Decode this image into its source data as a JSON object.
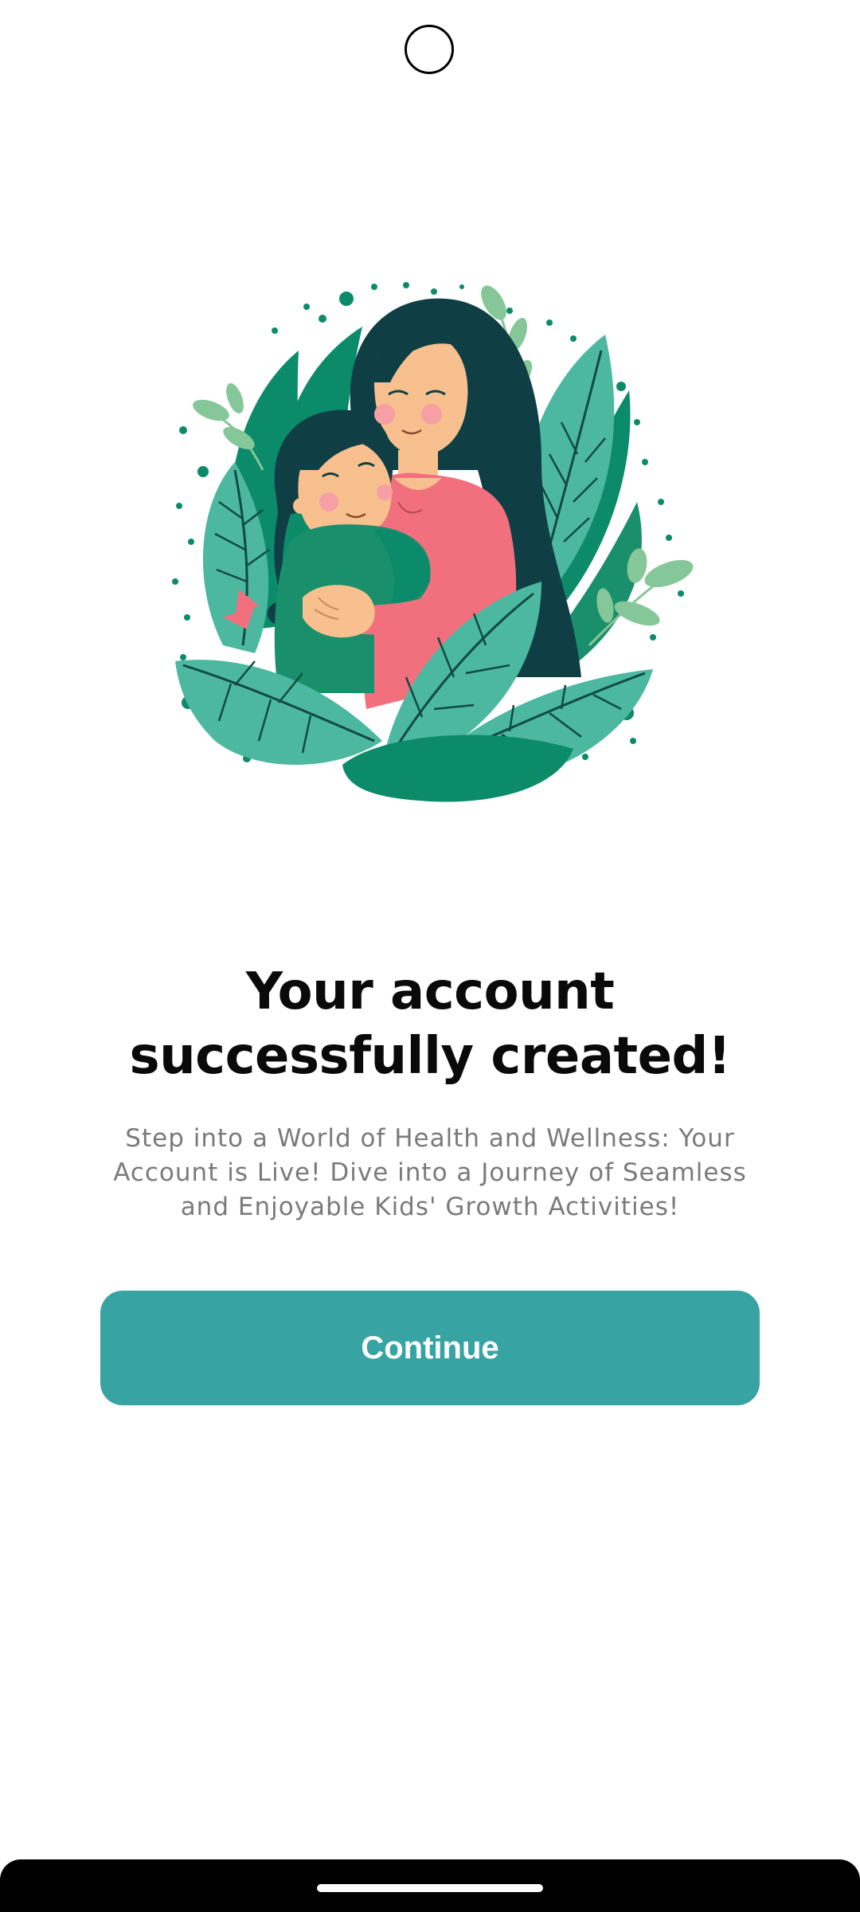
{
  "screen": {
    "title": "Your account successfully created!",
    "subtitle": "Step into a World of Health and Wellness: Your Account is Live! Dive into a Journey of Seamless and Enjoyable Kids' Growth Activities!",
    "continue_label": "Continue"
  },
  "illustration": {
    "icon": "mother-hugging-child-illustration",
    "colors": {
      "leaf_dark": "#0c8b6b",
      "leaf_teal": "#4cb8a0",
      "leaf_light": "#86c79a",
      "hair": "#0f3f44",
      "skin": "#f7c08e",
      "shirt_mother": "#f2707e",
      "shirt_child": "#1a8f6c"
    }
  },
  "colors": {
    "accent": "#37a3a3",
    "title": "#0a0a0a",
    "subtitle": "#7a7a7a",
    "background": "#ffffff"
  }
}
